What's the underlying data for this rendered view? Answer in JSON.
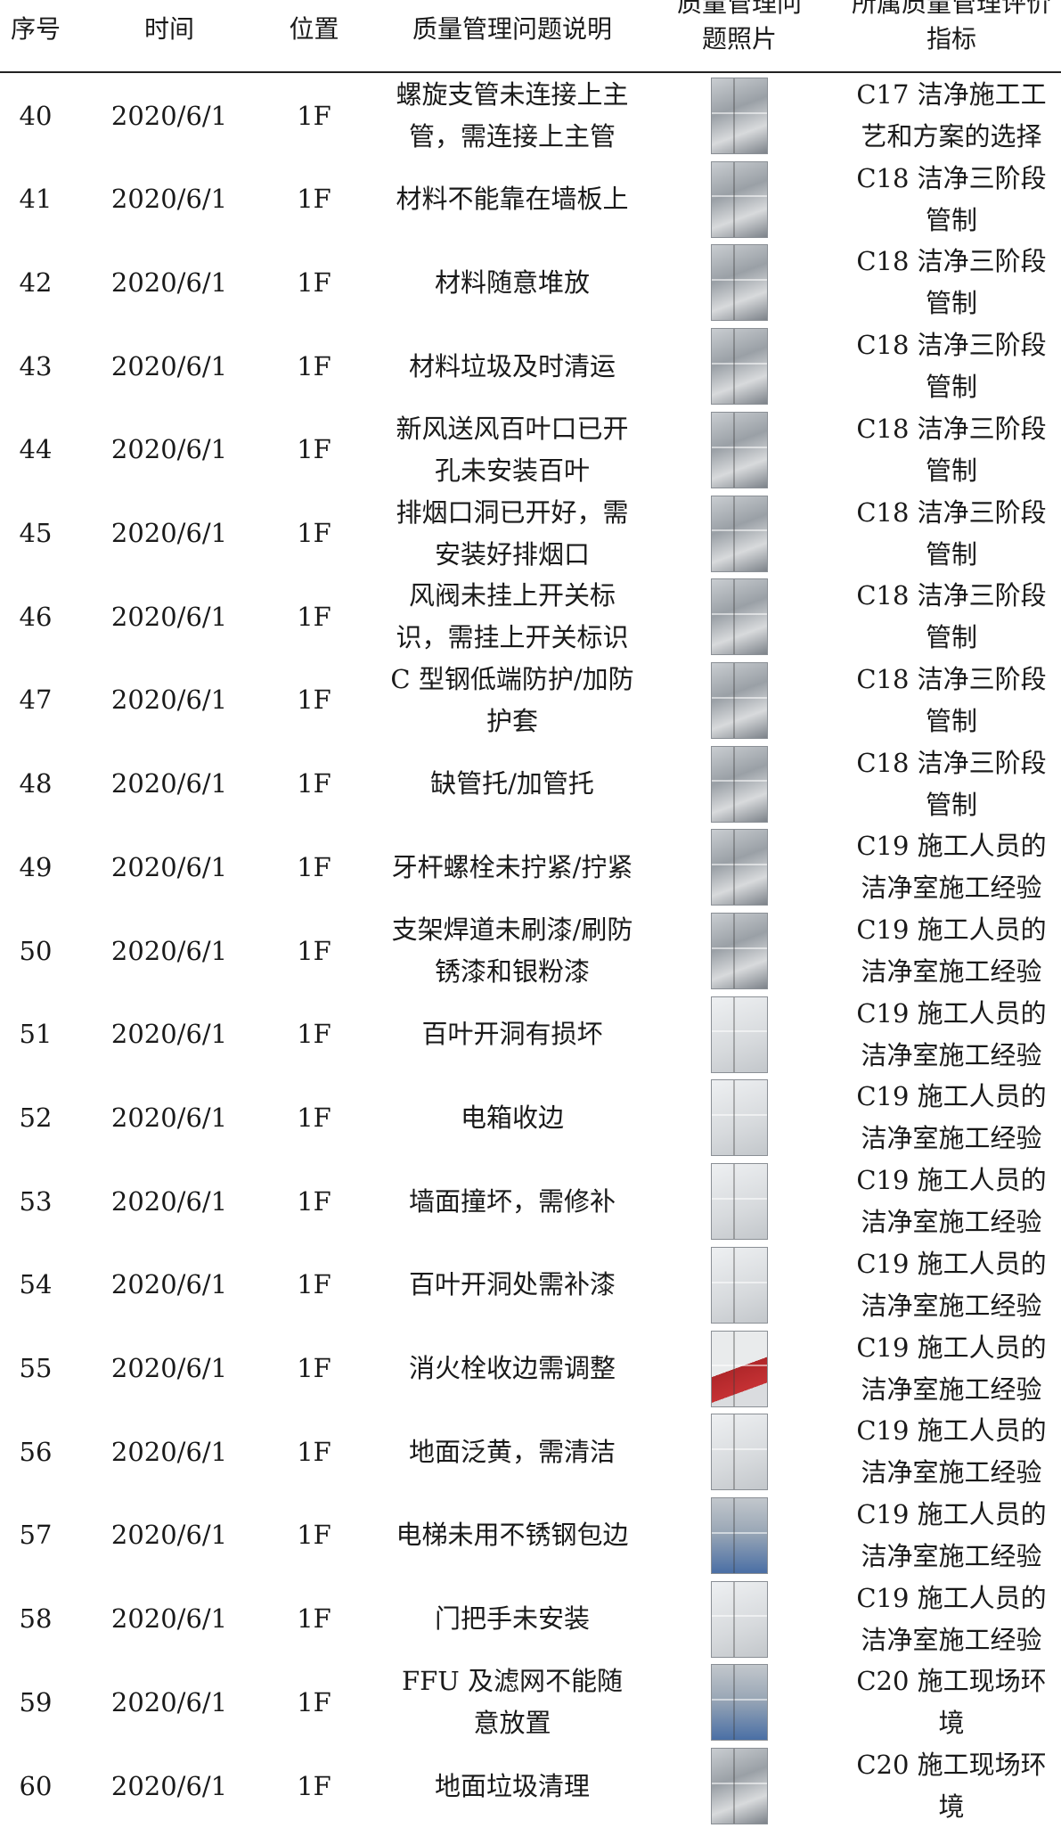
{
  "header": {
    "no": "序号",
    "date": "时间",
    "loc": "位置",
    "desc": "质量管理问题说明",
    "photo": "质量管理问题照片",
    "indicator": "所属质量管理评价指标"
  },
  "rows": [
    {
      "no": "40",
      "date": "2020/6/1",
      "loc": "1F",
      "desc": "螺旋支管未连接上主管，需连接上主管",
      "indicator": "C17 洁净施工工艺和方案的选择",
      "photo": "duct-photo"
    },
    {
      "no": "41",
      "date": "2020/6/1",
      "loc": "1F",
      "desc": "材料不能靠在墙板上",
      "indicator": "C18 洁净三阶段管制",
      "photo": "wall-panel-photo"
    },
    {
      "no": "42",
      "date": "2020/6/1",
      "loc": "1F",
      "desc": "材料随意堆放",
      "indicator": "C18 洁净三阶段管制",
      "photo": "material-photo"
    },
    {
      "no": "43",
      "date": "2020/6/1",
      "loc": "1F",
      "desc": "材料垃圾及时清运",
      "indicator": "C18 洁净三阶段管制",
      "photo": "debris-photo"
    },
    {
      "no": "44",
      "date": "2020/6/1",
      "loc": "1F",
      "desc": "新风送风百叶口已开孔未安装百叶",
      "indicator": "C18 洁净三阶段管制",
      "photo": "vent-opening-photo"
    },
    {
      "no": "45",
      "date": "2020/6/1",
      "loc": "1F",
      "desc": "排烟口洞已开好，需安装好排烟口",
      "indicator": "C18 洁净三阶段管制",
      "photo": "smoke-vent-photo"
    },
    {
      "no": "46",
      "date": "2020/6/1",
      "loc": "1F",
      "desc": "风阀未挂上开关标识，需挂上开关标识",
      "indicator": "C18 洁净三阶段管制",
      "photo": "damper-photo"
    },
    {
      "no": "47",
      "date": "2020/6/1",
      "loc": "1F",
      "desc": "C 型钢低端防护/加防护套",
      "indicator": "C18 洁净三阶段管制",
      "photo": "steel-photo"
    },
    {
      "no": "48",
      "date": "2020/6/1",
      "loc": "1F",
      "desc": "缺管托/加管托",
      "indicator": "C18 洁净三阶段管制",
      "photo": "pipe-support-photo"
    },
    {
      "no": "49",
      "date": "2020/6/1",
      "loc": "1F",
      "desc": "牙杆螺栓未拧紧/拧紧",
      "indicator": "C19 施工人员的洁净室施工经验",
      "photo": "bolt-photo"
    },
    {
      "no": "50",
      "date": "2020/6/1",
      "loc": "1F",
      "desc": "支架焊道未刷漆/刷防锈漆和银粉漆",
      "indicator": "C19 施工人员的洁净室施工经验",
      "photo": "bracket-photo"
    },
    {
      "no": "51",
      "date": "2020/6/1",
      "loc": "1F",
      "desc": "百叶开洞有损坏",
      "indicator": "C19 施工人员的洁净室施工经验",
      "photo": "louver-photo"
    },
    {
      "no": "52",
      "date": "2020/6/1",
      "loc": "1F",
      "desc": "电箱收边",
      "indicator": "C19 施工人员的洁净室施工经验",
      "photo": "electric-box-photo"
    },
    {
      "no": "53",
      "date": "2020/6/1",
      "loc": "1F",
      "desc": "墙面撞坏，需修补",
      "indicator": "C19 施工人员的洁净室施工经验",
      "photo": "wall-damage-photo"
    },
    {
      "no": "54",
      "date": "2020/6/1",
      "loc": "1F",
      "desc": "百叶开洞处需补漆",
      "indicator": "C19 施工人员的洁净室施工经验",
      "photo": "louver-paint-photo"
    },
    {
      "no": "55",
      "date": "2020/6/1",
      "loc": "1F",
      "desc": "消火栓收边需调整",
      "indicator": "C19 施工人员的洁净室施工经验",
      "photo": "hydrant-photo"
    },
    {
      "no": "56",
      "date": "2020/6/1",
      "loc": "1F",
      "desc": "地面泛黄，需清洁",
      "indicator": "C19 施工人员的洁净室施工经验",
      "photo": "floor-photo"
    },
    {
      "no": "57",
      "date": "2020/6/1",
      "loc": "1F",
      "desc": "电梯未用不锈钢包边",
      "indicator": "C19 施工人员的洁净室施工经验",
      "photo": "elevator-photo"
    },
    {
      "no": "58",
      "date": "2020/6/1",
      "loc": "1F",
      "desc": "门把手未安装",
      "indicator": "C19 施工人员的洁净室施工经验",
      "photo": "door-photo"
    },
    {
      "no": "59",
      "date": "2020/6/1",
      "loc": "1F",
      "desc": "FFU 及滤网不能随意放置",
      "indicator": "C20 施工现场环境",
      "photo": "ffu-photo"
    },
    {
      "no": "60",
      "date": "2020/6/1",
      "loc": "1F",
      "desc": "地面垃圾清理",
      "indicator": "C20 施工现场环境",
      "photo": "floor-debris-photo"
    }
  ]
}
